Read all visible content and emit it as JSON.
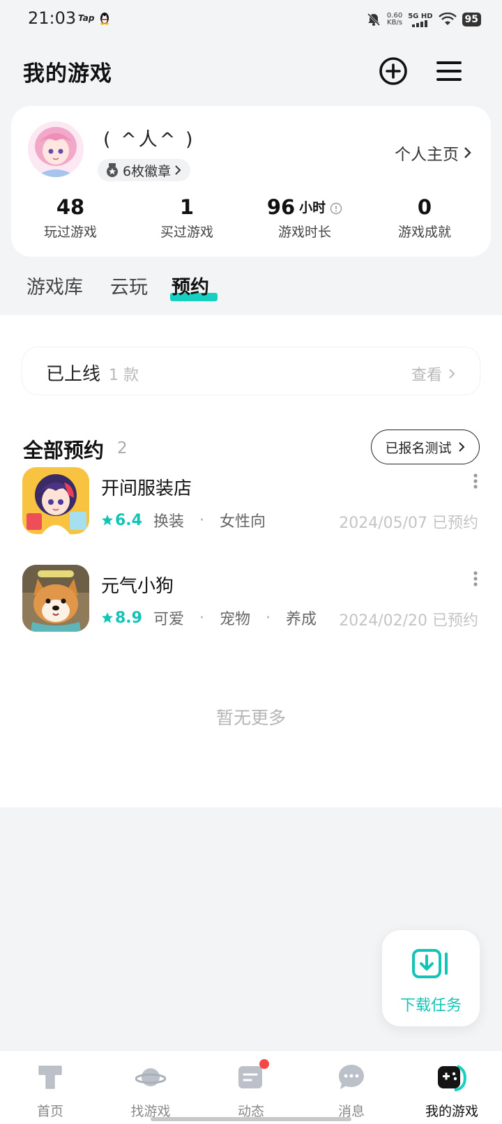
{
  "status_bar": {
    "time": "21:03",
    "app_badge": "Tap",
    "net_speed_value": "0.60",
    "net_speed_unit": "KB/s",
    "network": "5G HD",
    "battery": "95"
  },
  "header": {
    "title": "我的游戏",
    "icons": [
      "add-circle-icon",
      "menu-icon"
    ]
  },
  "profile": {
    "nickname": "( ^人^ )",
    "badge_label": "6枚徽章",
    "home_link": "个人主页",
    "stats": [
      {
        "value": "48",
        "unit": "",
        "label": "玩过游戏"
      },
      {
        "value": "1",
        "unit": "",
        "label": "买过游戏"
      },
      {
        "value": "96",
        "unit": "小时",
        "label": "游戏时长"
      },
      {
        "value": "0",
        "unit": "",
        "label": "游戏成就"
      }
    ]
  },
  "tabs": [
    {
      "label": "游戏库",
      "active": false
    },
    {
      "label": "云玩",
      "active": false
    },
    {
      "label": "预约",
      "active": true
    }
  ],
  "online": {
    "title": "已上线",
    "count": "1 款",
    "view_label": "查看"
  },
  "reservations": {
    "title": "全部预约",
    "count": "2",
    "test_button": "已报名测试",
    "games": [
      {
        "name": "开间服装店",
        "score": "6.4",
        "tags": [
          "换装",
          "女性向"
        ],
        "date": "2024/05/07 已预约"
      },
      {
        "name": "元气小狗",
        "score": "8.9",
        "tags": [
          "可爱",
          "宠物",
          "养成"
        ],
        "date": "2024/02/20 已预约"
      }
    ],
    "empty_hint": "暂无更多"
  },
  "download_float": {
    "label": "下载任务"
  },
  "bottom_nav": [
    {
      "label": "首页",
      "icon": "home-icon",
      "active": false
    },
    {
      "label": "找游戏",
      "icon": "planet-icon",
      "active": false
    },
    {
      "label": "动态",
      "icon": "feed-icon",
      "active": false,
      "dot": true
    },
    {
      "label": "消息",
      "icon": "message-icon",
      "active": false
    },
    {
      "label": "我的游戏",
      "icon": "gamepad-icon",
      "active": true
    }
  ],
  "colors": {
    "accent": "#13c4b6",
    "background": "#f3f4f6",
    "notification_dot": "#f24848"
  }
}
